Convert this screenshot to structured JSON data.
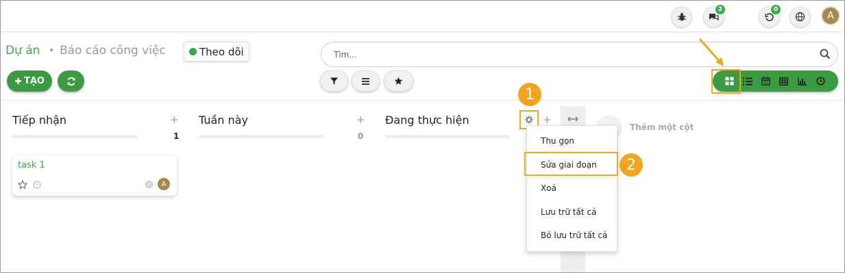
{
  "topbar": {
    "chat_badge": "2",
    "history_badge": "0",
    "avatar_letter": "A"
  },
  "breadcrumb": {
    "current": "Dự án",
    "separator": "•",
    "sub": "Báo cáo công việc"
  },
  "follow_button": "Theo dõi",
  "toolbar": {
    "create_label": "TẠO",
    "search_placeholder": "Tìm..."
  },
  "columns": [
    {
      "title": "Tiếp nhận",
      "add": "+",
      "count": "1"
    },
    {
      "title": "Tuần này",
      "add": "+",
      "count": "0"
    },
    {
      "title": "Đang thực hiện",
      "add": "+"
    }
  ],
  "card": {
    "title": "task 1",
    "assignee": "A"
  },
  "add_column_label": "Thêm một cột",
  "context_menu": {
    "items": [
      "Thu gọn",
      "Sửa giai đoạn",
      "Xoá",
      "Lưu trữ tất cả",
      "Bỏ lưu trữ tất cả"
    ]
  },
  "steps": [
    "1",
    "2"
  ],
  "colors": {
    "accent": "#3a9b40",
    "highlight": "#f0a81c",
    "step": "#f4a31c"
  },
  "icons": [
    "bug-icon",
    "chat-icon",
    "history-icon",
    "globe-icon",
    "plus-icon",
    "refresh-icon",
    "filter-icon",
    "list-icon",
    "star-icon",
    "search-icon",
    "kanban-icon",
    "calendar-icon",
    "table-icon",
    "chart-icon",
    "clock-icon",
    "gear-icon",
    "expand-icon"
  ]
}
